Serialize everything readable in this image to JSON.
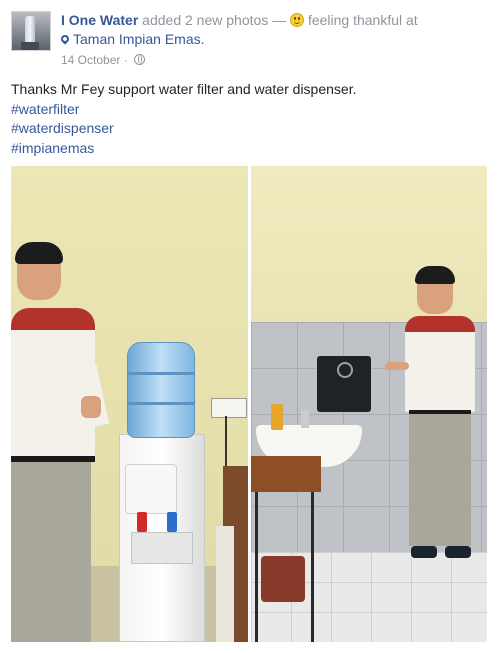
{
  "post": {
    "author": "I One Water",
    "action": "added 2 new photos —",
    "feeling": "feeling thankful at",
    "location": "Taman Impian Emas.",
    "date": "14 October",
    "date_separator": "·",
    "message": "Thanks Mr Fey support water filter and water dispenser.",
    "hashtags": [
      "#waterfilter",
      "#waterdispenser",
      "#impianemas"
    ]
  },
  "photos": [
    {
      "name": "photo-water-dispenser",
      "depicts": "man giving thumbs up beside water dispenser"
    },
    {
      "name": "photo-water-filter",
      "depicts": "man giving thumbs up beside wall-mounted water filter above sink"
    }
  ],
  "colors": {
    "link": "#365899",
    "muted": "#90949c",
    "text": "#1d2129"
  }
}
